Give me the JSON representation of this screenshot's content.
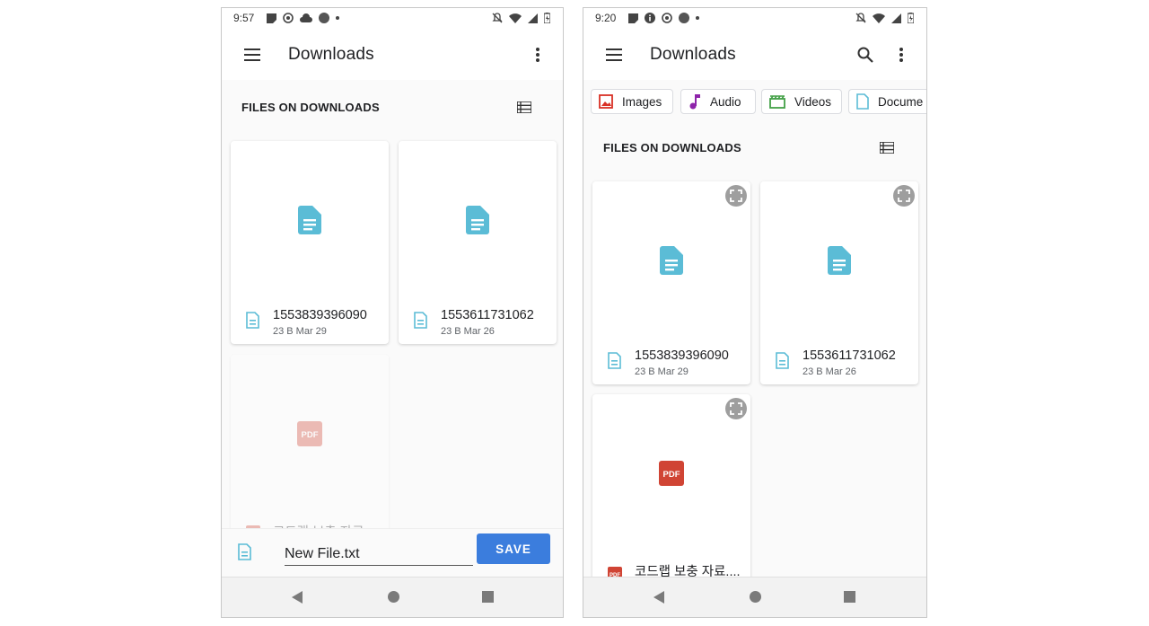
{
  "left": {
    "status": {
      "time": "9:57"
    },
    "app_bar": {
      "title": "Downloads"
    },
    "section_title": "FILES ON DOWNLOADS",
    "files": [
      {
        "name": "1553839396090",
        "meta": "23 B Mar 29",
        "icon": "document-icon"
      },
      {
        "name": "1553611731062",
        "meta": "23 B Mar 26",
        "icon": "document-icon"
      },
      {
        "name": "코드랩 보충 자료.",
        "meta": "",
        "icon": "pdf-icon",
        "badge": "PDF"
      }
    ],
    "save_bar": {
      "filename_value": "New File.txt",
      "save_label": "SAVE"
    }
  },
  "right": {
    "status": {
      "time": "9:20"
    },
    "app_bar": {
      "title": "Downloads"
    },
    "chips": [
      {
        "label": "Images",
        "icon": "image-icon",
        "color": "#d93025"
      },
      {
        "label": "Audio",
        "icon": "music-note-icon",
        "color": "#8e24aa"
      },
      {
        "label": "Videos",
        "icon": "video-icon",
        "color": "#43a047"
      },
      {
        "label": "Docume",
        "icon": "document-outline-icon",
        "color": "#5bbcd6"
      }
    ],
    "section_title": "FILES ON DOWNLOADS",
    "files": [
      {
        "name": "1553839396090",
        "meta": "23 B Mar 29",
        "icon": "document-icon"
      },
      {
        "name": "1553611731062",
        "meta": "23 B Mar 26",
        "icon": "document-icon"
      },
      {
        "name": "코드랩 보충 자료....",
        "meta": "",
        "icon": "pdf-icon",
        "badge": "PDF"
      }
    ]
  },
  "colors": {
    "doc_icon": "#5bbcd6",
    "pdf_red": "#d04434",
    "save_blue": "#3b7ddd"
  }
}
